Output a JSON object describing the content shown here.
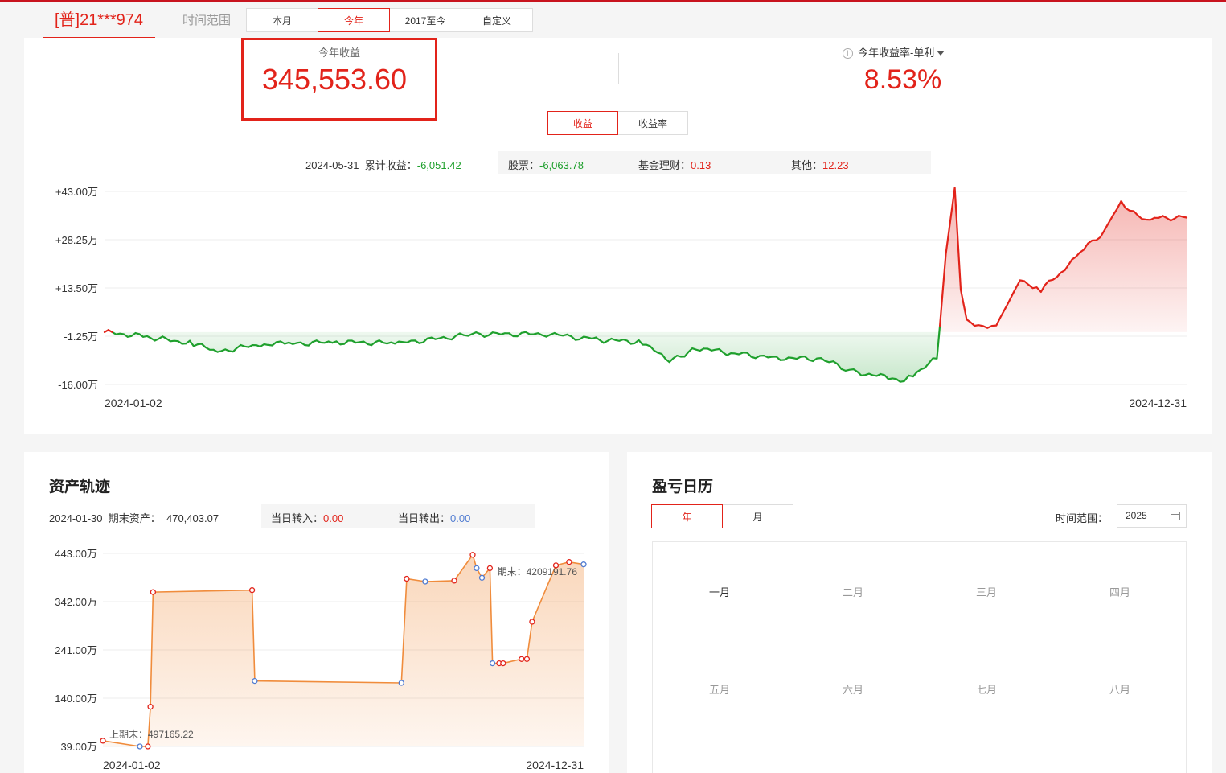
{
  "header": {
    "account": "[普]21***974",
    "range_label": "时间范围",
    "range_tabs": [
      {
        "label": "本月",
        "active": false
      },
      {
        "label": "今年",
        "active": true
      },
      {
        "label": "2017至今",
        "active": false
      },
      {
        "label": "自定义",
        "active": false
      }
    ]
  },
  "summary": {
    "profit_label": "今年收益",
    "profit_value": "345,553.60",
    "rate_label": "今年收益率-单利",
    "rate_value": "8.53%",
    "mode_tabs": [
      {
        "label": "收益",
        "active": true
      },
      {
        "label": "收益率",
        "active": false
      }
    ]
  },
  "profit_info": {
    "date": "2024-05-31",
    "cum_label": "累计收益：",
    "cum_value": "-6,051.42",
    "stock_label": "股票：",
    "stock_value": "-6,063.78",
    "fund_label": "基金理财：",
    "fund_value": "0.13",
    "other_label": "其他：",
    "other_value": "12.23"
  },
  "asset_section": {
    "title": "资产轨迹",
    "date": "2024-01-30",
    "end_label": "期末资产：",
    "end_value": "470,403.07",
    "in_label": "当日转入：",
    "in_value": "0.00",
    "out_label": "当日转出：",
    "out_value": "0.00"
  },
  "calendar": {
    "title": "盈亏日历",
    "tabs": [
      {
        "label": "年",
        "active": true
      },
      {
        "label": "月",
        "active": false
      }
    ],
    "range_label": "时间范围：",
    "year": "2025",
    "months": [
      "一月",
      "二月",
      "三月",
      "四月",
      "五月",
      "六月",
      "七月",
      "八月"
    ],
    "current_month": "一月"
  },
  "colors": {
    "accent": "#e2231a",
    "positive": "#e2231a",
    "negative": "#1fa02d",
    "asset_line": "#f08c3c",
    "transfer_in_marker": "#e2231a",
    "transfer_out_marker": "#4f7bd1"
  },
  "chart_data": [
    {
      "type": "area",
      "title": "",
      "x_unit": "date",
      "y_unit": "万",
      "ylim": [
        -16.0,
        43.0
      ],
      "y_ticks": [
        "+43.00万",
        "+28.25万",
        "+13.50万",
        "-1.25万",
        "-16.00万"
      ],
      "x_ticks": [
        "2024-01-02",
        "2024-12-31"
      ],
      "baseline": 0,
      "grid": "horizontal",
      "series": [
        {
          "x": [
            "2024-01-02",
            "2024-01-15",
            "2024-02-01",
            "2024-02-09",
            "2024-02-26",
            "2024-03-04",
            "2024-03-20",
            "2024-04-10",
            "2024-05-06",
            "2024-05-31",
            "2024-06-14",
            "2024-07-01",
            "2024-07-10",
            "2024-07-19",
            "2024-08-01",
            "2024-08-15",
            "2024-08-30",
            "2024-09-10",
            "2024-09-23",
            "2024-09-27",
            "2024-09-30",
            "2024-10-08",
            "2024-10-09",
            "2024-10-11",
            "2024-10-14",
            "2024-10-16",
            "2024-10-18",
            "2024-10-22",
            "2024-10-28",
            "2024-11-05",
            "2024-11-12",
            "2024-11-20",
            "2024-11-25",
            "2024-12-02",
            "2024-12-09",
            "2024-12-16",
            "2024-12-23",
            "2024-12-31"
          ],
          "y": [
            0.0,
            -1.3,
            -3.5,
            -6.0,
            -3.3,
            -3.6,
            -3.0,
            -3.4,
            -0.6,
            -0.6,
            -2.2,
            -3.0,
            -9.0,
            -4.8,
            -6.5,
            -7.9,
            -8.1,
            -12.2,
            -14.0,
            -15.3,
            -13.0,
            -8.0,
            2.0,
            24.0,
            44.0,
            13.0,
            3.0,
            2.0,
            2.0,
            16.0,
            13.0,
            19.0,
            25.0,
            29.0,
            40.0,
            34.0,
            35.0,
            35.0
          ]
        }
      ]
    },
    {
      "type": "area",
      "title": "",
      "x_unit": "date",
      "y_unit": "万",
      "ylim": [
        39.0,
        443.0
      ],
      "y_ticks": [
        "443.00万",
        "342.00万",
        "241.00万",
        "140.00万",
        "39.00万"
      ],
      "x_ticks": [
        "2024-01-02",
        "2024-12-31"
      ],
      "annotations": [
        {
          "text": "上期末：497165.22"
        },
        {
          "text": "期末：4209191.76"
        }
      ],
      "series": [
        {
          "name": "资产",
          "x": [
            "2024-01-02",
            "2024-01-30",
            "2024-02-05",
            "2024-02-07",
            "2024-02-09",
            "2024-04-24",
            "2024-04-26",
            "2024-08-15",
            "2024-08-19",
            "2024-09-02",
            "2024-09-24",
            "2024-10-08",
            "2024-10-11",
            "2024-10-15",
            "2024-10-21",
            "2024-10-23",
            "2024-10-28",
            "2024-10-31",
            "2024-11-14",
            "2024-11-18",
            "2024-11-22",
            "2024-12-10",
            "2024-12-20",
            "2024-12-31"
          ],
          "y": [
            51,
            39,
            39,
            122,
            362,
            366,
            176,
            172,
            390,
            384,
            386,
            440,
            412,
            392,
            412,
            213,
            213,
            213,
            222,
            222,
            300,
            418,
            425,
            420
          ]
        }
      ]
    }
  ]
}
